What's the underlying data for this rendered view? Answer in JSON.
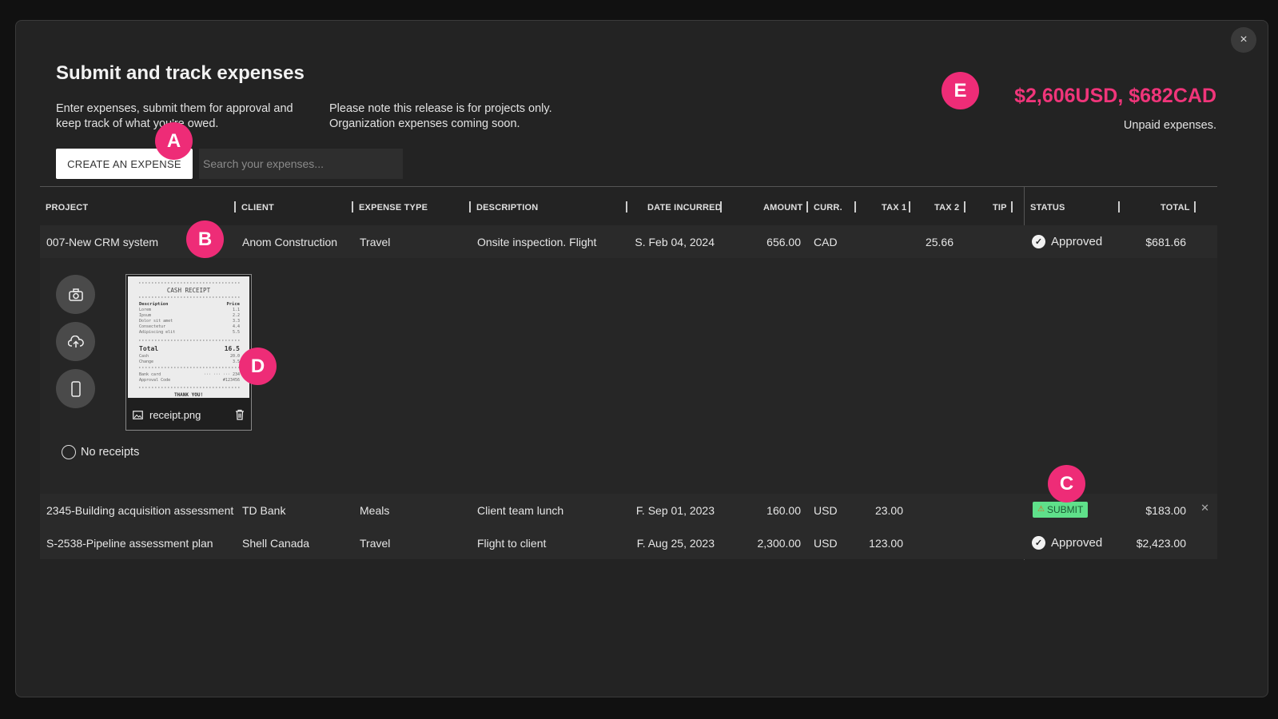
{
  "modal": {
    "close_label": "×",
    "title_plain": "Submit and ",
    "title_bold": "track expenses",
    "intro": "Enter expenses, submit them for approval and keep track of what you're owed.",
    "note": "Please note this release is for projects only. Organization expenses coming soon.",
    "create_button": "CREATE AN EXPENSE",
    "search_placeholder": "Search your expenses...",
    "unpaid_amount": "$2,606USD, $682CAD",
    "unpaid_label": "Unpaid expenses."
  },
  "table": {
    "headers": {
      "project": "PROJECT",
      "client": "CLIENT",
      "expense_type": "EXPENSE TYPE",
      "description": "DESCRIPTION",
      "date_incurred": "DATE INCURRED",
      "amount": "AMOUNT",
      "currency": "CURR.",
      "tax1": "TAX 1",
      "tax2": "TAX 2",
      "tip": "TIP",
      "status": "STATUS",
      "total": "TOTAL"
    },
    "rows": [
      {
        "project": "007-New CRM system",
        "client": "Anom Construction",
        "expense_type": "Travel",
        "description": "Onsite inspection. Flight",
        "date_incurred": "S. Feb 04, 2024",
        "amount": "656.00",
        "currency": "CAD",
        "tax1": "",
        "tax2": "25.66",
        "status": "Approved",
        "total": "$681.66"
      },
      {
        "project": "2345-Building acquisition assessment",
        "client": "TD Bank",
        "expense_type": "Meals",
        "description": "Client team lunch",
        "date_incurred": "F. Sep 01, 2023",
        "amount": "160.00",
        "currency": "USD",
        "tax1": "23.00",
        "tax2": "",
        "status": "SUBMIT",
        "total": "$183.00"
      },
      {
        "project": "S-2538-Pipeline assessment plan",
        "client": "Shell Canada",
        "expense_type": "Travel",
        "description": "Flight to client",
        "date_incurred": "F. Aug 25, 2023",
        "amount": "2,300.00",
        "currency": "USD",
        "tax1": "123.00",
        "tax2": "",
        "status": "Approved",
        "total": "$2,423.00"
      }
    ]
  },
  "expanded": {
    "receipt_filename": "receipt.png",
    "no_receipts_label": "No receipts",
    "receipt_image": {
      "header": "CASH RECEIPT",
      "col_desc": "Description",
      "col_price": "Price",
      "items": [
        {
          "name": "Lorem",
          "price": "1.1"
        },
        {
          "name": "Ipsum",
          "price": "2.2"
        },
        {
          "name": "Dolor sit amet",
          "price": "3.3"
        },
        {
          "name": "Consectetur",
          "price": "4.4"
        },
        {
          "name": "Adipiscing elit",
          "price": "5.5"
        }
      ],
      "total_label": "Total",
      "total_value": "16.5",
      "cash_label": "Cash",
      "cash_value": "20.0",
      "change_label": "Change",
      "change_value": "3.5",
      "bank_label": "Bank card",
      "bank_value": "··· ··· ··· 234",
      "approval_label": "Approval Code",
      "approval_value": "#123456",
      "thanks": "THANK YOU!"
    }
  },
  "markers": {
    "a": "A",
    "b": "B",
    "c": "C",
    "d": "D",
    "e": "E"
  },
  "colors": {
    "accent": "#ee2c77",
    "submit_bg": "#5fe08a",
    "amount_text": "#f0357a"
  }
}
